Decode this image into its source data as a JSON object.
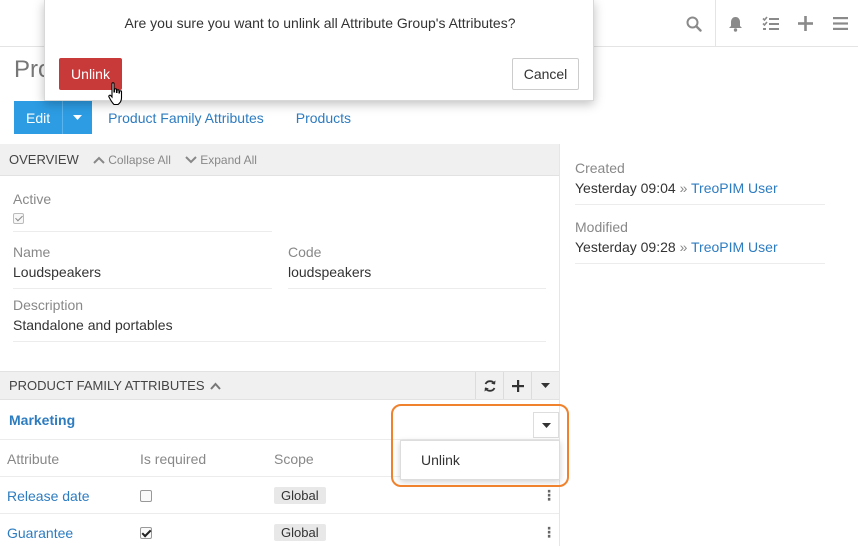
{
  "modal": {
    "message": "Are you sure you want to unlink all Attribute Group's Attributes?",
    "unlink_label": "Unlink",
    "cancel_label": "Cancel"
  },
  "header": {
    "icons": [
      "search-icon",
      "bell-icon",
      "tasks-icon",
      "plus-icon",
      "menu-icon"
    ]
  },
  "page": {
    "title": "Pro"
  },
  "actions": {
    "edit_label": "Edit",
    "tabs": [
      "Product Family Attributes",
      "Products"
    ]
  },
  "overview": {
    "title": "OVERVIEW",
    "collapse_all": "Collapse All",
    "expand_all": "Expand All",
    "fields": {
      "active_label": "Active",
      "name_label": "Name",
      "name_value": "Loudspeakers",
      "code_label": "Code",
      "code_value": "loudspeakers",
      "description_label": "Description",
      "description_value": "Standalone and portables"
    }
  },
  "pfa": {
    "title": "PRODUCT FAMILY ATTRIBUTES",
    "group_name": "Marketing",
    "columns": [
      "Attribute",
      "Is required",
      "Scope"
    ],
    "rows": [
      {
        "attribute": "Release date",
        "required": false,
        "scope": "Global"
      },
      {
        "attribute": "Guarantee",
        "required": true,
        "scope": "Global"
      }
    ],
    "dropdown_item": "Unlink"
  },
  "side": {
    "created_label": "Created",
    "created_time": "Yesterday 09:04",
    "created_sep": "»",
    "created_user": "TreoPIM User",
    "modified_label": "Modified",
    "modified_time": "Yesterday 09:28",
    "modified_sep": "»",
    "modified_user": "TreoPIM User"
  },
  "colors": {
    "primary": "#2d9ce3",
    "danger": "#c8393a",
    "highlight": "#f0822d",
    "link": "#2d7cc0"
  }
}
